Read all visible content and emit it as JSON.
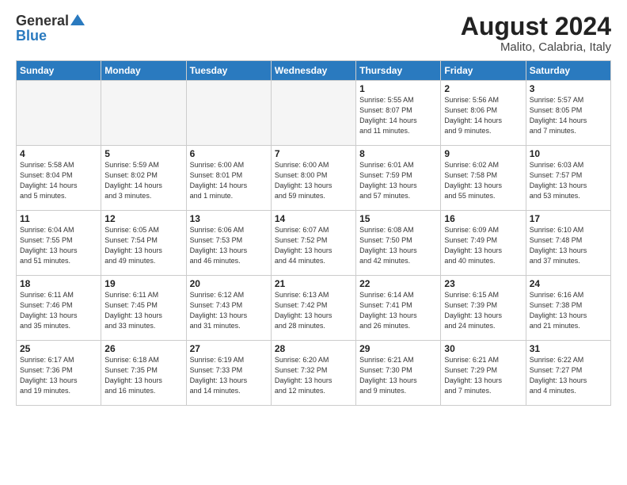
{
  "header": {
    "logo_general": "General",
    "logo_blue": "Blue",
    "title": "August 2024",
    "subtitle": "Malito, Calabria, Italy"
  },
  "weekdays": [
    "Sunday",
    "Monday",
    "Tuesday",
    "Wednesday",
    "Thursday",
    "Friday",
    "Saturday"
  ],
  "weeks": [
    [
      {
        "day": "",
        "info": ""
      },
      {
        "day": "",
        "info": ""
      },
      {
        "day": "",
        "info": ""
      },
      {
        "day": "",
        "info": ""
      },
      {
        "day": "1",
        "info": "Sunrise: 5:55 AM\nSunset: 8:07 PM\nDaylight: 14 hours\nand 11 minutes."
      },
      {
        "day": "2",
        "info": "Sunrise: 5:56 AM\nSunset: 8:06 PM\nDaylight: 14 hours\nand 9 minutes."
      },
      {
        "day": "3",
        "info": "Sunrise: 5:57 AM\nSunset: 8:05 PM\nDaylight: 14 hours\nand 7 minutes."
      }
    ],
    [
      {
        "day": "4",
        "info": "Sunrise: 5:58 AM\nSunset: 8:04 PM\nDaylight: 14 hours\nand 5 minutes."
      },
      {
        "day": "5",
        "info": "Sunrise: 5:59 AM\nSunset: 8:02 PM\nDaylight: 14 hours\nand 3 minutes."
      },
      {
        "day": "6",
        "info": "Sunrise: 6:00 AM\nSunset: 8:01 PM\nDaylight: 14 hours\nand 1 minute."
      },
      {
        "day": "7",
        "info": "Sunrise: 6:00 AM\nSunset: 8:00 PM\nDaylight: 13 hours\nand 59 minutes."
      },
      {
        "day": "8",
        "info": "Sunrise: 6:01 AM\nSunset: 7:59 PM\nDaylight: 13 hours\nand 57 minutes."
      },
      {
        "day": "9",
        "info": "Sunrise: 6:02 AM\nSunset: 7:58 PM\nDaylight: 13 hours\nand 55 minutes."
      },
      {
        "day": "10",
        "info": "Sunrise: 6:03 AM\nSunset: 7:57 PM\nDaylight: 13 hours\nand 53 minutes."
      }
    ],
    [
      {
        "day": "11",
        "info": "Sunrise: 6:04 AM\nSunset: 7:55 PM\nDaylight: 13 hours\nand 51 minutes."
      },
      {
        "day": "12",
        "info": "Sunrise: 6:05 AM\nSunset: 7:54 PM\nDaylight: 13 hours\nand 49 minutes."
      },
      {
        "day": "13",
        "info": "Sunrise: 6:06 AM\nSunset: 7:53 PM\nDaylight: 13 hours\nand 46 minutes."
      },
      {
        "day": "14",
        "info": "Sunrise: 6:07 AM\nSunset: 7:52 PM\nDaylight: 13 hours\nand 44 minutes."
      },
      {
        "day": "15",
        "info": "Sunrise: 6:08 AM\nSunset: 7:50 PM\nDaylight: 13 hours\nand 42 minutes."
      },
      {
        "day": "16",
        "info": "Sunrise: 6:09 AM\nSunset: 7:49 PM\nDaylight: 13 hours\nand 40 minutes."
      },
      {
        "day": "17",
        "info": "Sunrise: 6:10 AM\nSunset: 7:48 PM\nDaylight: 13 hours\nand 37 minutes."
      }
    ],
    [
      {
        "day": "18",
        "info": "Sunrise: 6:11 AM\nSunset: 7:46 PM\nDaylight: 13 hours\nand 35 minutes."
      },
      {
        "day": "19",
        "info": "Sunrise: 6:11 AM\nSunset: 7:45 PM\nDaylight: 13 hours\nand 33 minutes."
      },
      {
        "day": "20",
        "info": "Sunrise: 6:12 AM\nSunset: 7:43 PM\nDaylight: 13 hours\nand 31 minutes."
      },
      {
        "day": "21",
        "info": "Sunrise: 6:13 AM\nSunset: 7:42 PM\nDaylight: 13 hours\nand 28 minutes."
      },
      {
        "day": "22",
        "info": "Sunrise: 6:14 AM\nSunset: 7:41 PM\nDaylight: 13 hours\nand 26 minutes."
      },
      {
        "day": "23",
        "info": "Sunrise: 6:15 AM\nSunset: 7:39 PM\nDaylight: 13 hours\nand 24 minutes."
      },
      {
        "day": "24",
        "info": "Sunrise: 6:16 AM\nSunset: 7:38 PM\nDaylight: 13 hours\nand 21 minutes."
      }
    ],
    [
      {
        "day": "25",
        "info": "Sunrise: 6:17 AM\nSunset: 7:36 PM\nDaylight: 13 hours\nand 19 minutes."
      },
      {
        "day": "26",
        "info": "Sunrise: 6:18 AM\nSunset: 7:35 PM\nDaylight: 13 hours\nand 16 minutes."
      },
      {
        "day": "27",
        "info": "Sunrise: 6:19 AM\nSunset: 7:33 PM\nDaylight: 13 hours\nand 14 minutes."
      },
      {
        "day": "28",
        "info": "Sunrise: 6:20 AM\nSunset: 7:32 PM\nDaylight: 13 hours\nand 12 minutes."
      },
      {
        "day": "29",
        "info": "Sunrise: 6:21 AM\nSunset: 7:30 PM\nDaylight: 13 hours\nand 9 minutes."
      },
      {
        "day": "30",
        "info": "Sunrise: 6:21 AM\nSunset: 7:29 PM\nDaylight: 13 hours\nand 7 minutes."
      },
      {
        "day": "31",
        "info": "Sunrise: 6:22 AM\nSunset: 7:27 PM\nDaylight: 13 hours\nand 4 minutes."
      }
    ]
  ]
}
